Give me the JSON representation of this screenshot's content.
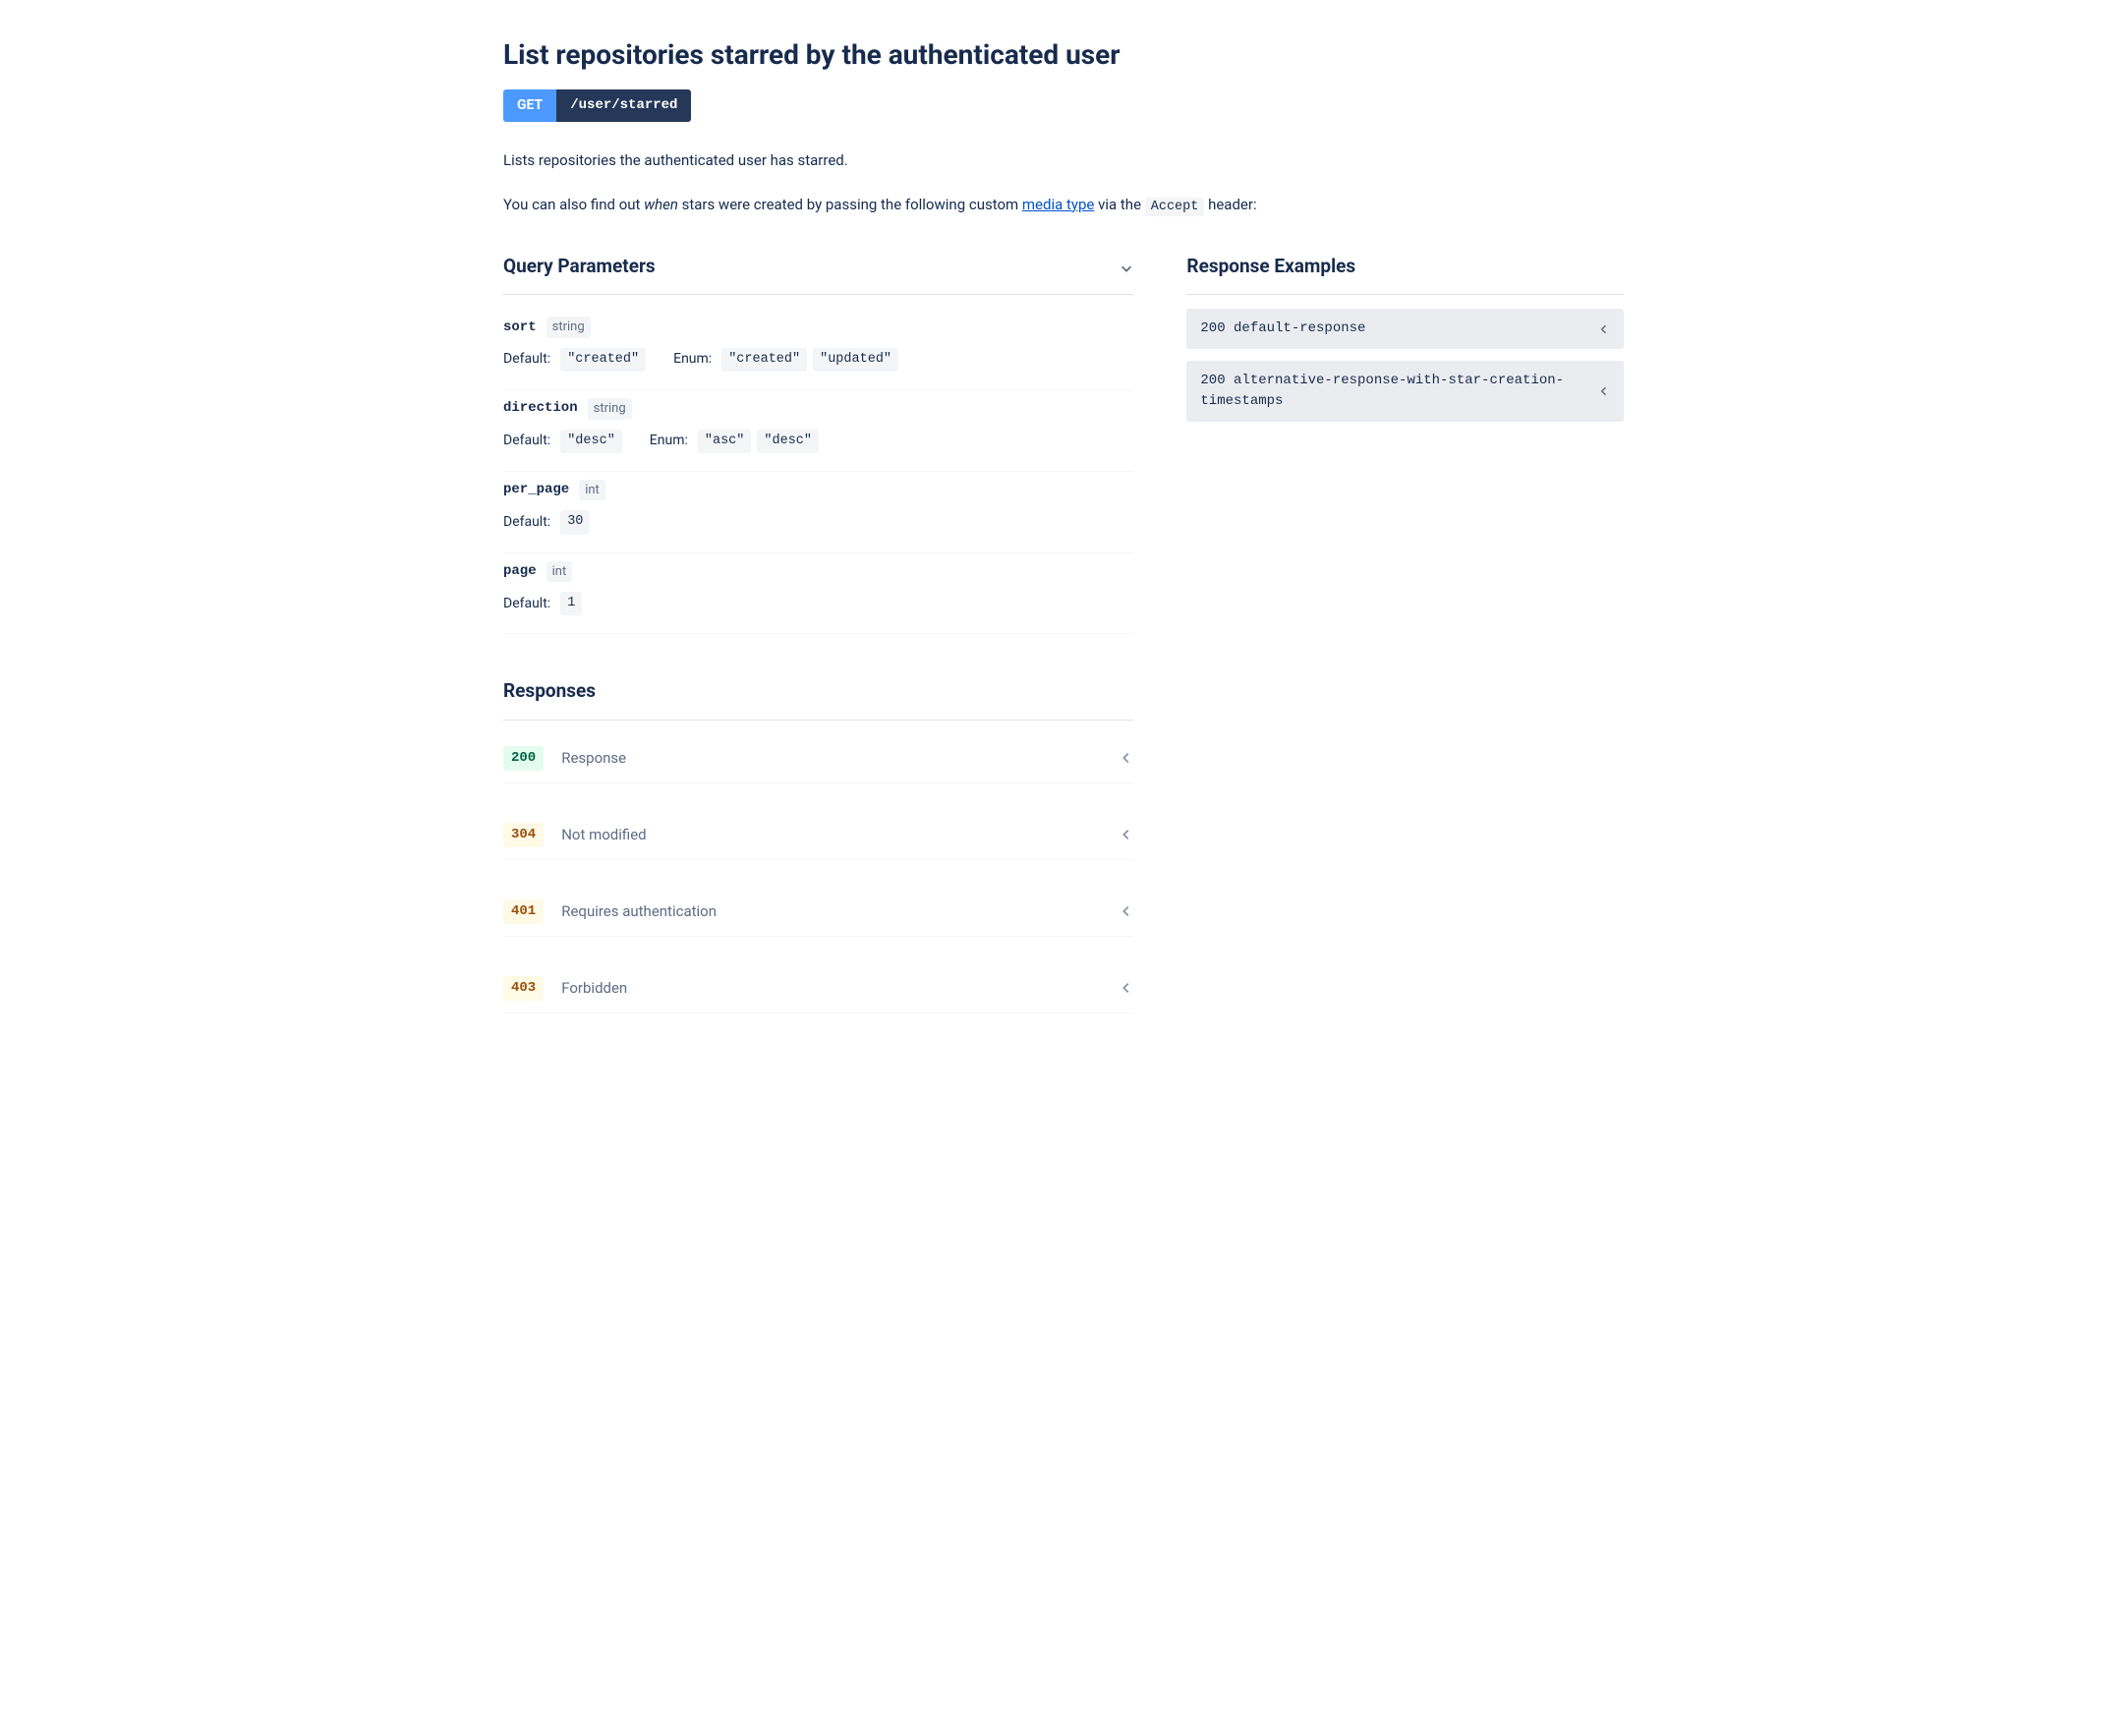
{
  "title": "List repositories starred by the authenticated user",
  "method": "GET",
  "path": "/user/starred",
  "description": {
    "line1": "Lists repositories the authenticated user has starred.",
    "line2_prefix": "You can also find out ",
    "line2_em": "when",
    "line2_mid": " stars were created by passing the following custom ",
    "line2_link": "media type",
    "line2_after_link": " via the ",
    "line2_code": "Accept",
    "line2_suffix": " header:"
  },
  "query_parameters": {
    "heading": "Query Parameters",
    "params": [
      {
        "name": "sort",
        "type": "string",
        "default": "\"created\"",
        "enum": [
          "\"created\"",
          "\"updated\""
        ]
      },
      {
        "name": "direction",
        "type": "string",
        "default": "\"desc\"",
        "enum": [
          "\"asc\"",
          "\"desc\""
        ]
      },
      {
        "name": "per_page",
        "type": "int",
        "default": "30",
        "enum": []
      },
      {
        "name": "page",
        "type": "int",
        "default": "1",
        "enum": []
      }
    ],
    "default_label": "Default:",
    "enum_label": "Enum:"
  },
  "responses": {
    "heading": "Responses",
    "items": [
      {
        "code": "200",
        "cls": "st-200",
        "text": "Response"
      },
      {
        "code": "304",
        "cls": "st-3xx",
        "text": "Not modified"
      },
      {
        "code": "401",
        "cls": "st-4xx",
        "text": "Requires authentication"
      },
      {
        "code": "403",
        "cls": "st-4xx",
        "text": "Forbidden"
      }
    ]
  },
  "response_examples": {
    "heading": "Response Examples",
    "items": [
      {
        "code": "200",
        "text": "default-response"
      },
      {
        "code": "200",
        "text": "alternative-response-with-star-creation-timestamps"
      }
    ]
  }
}
